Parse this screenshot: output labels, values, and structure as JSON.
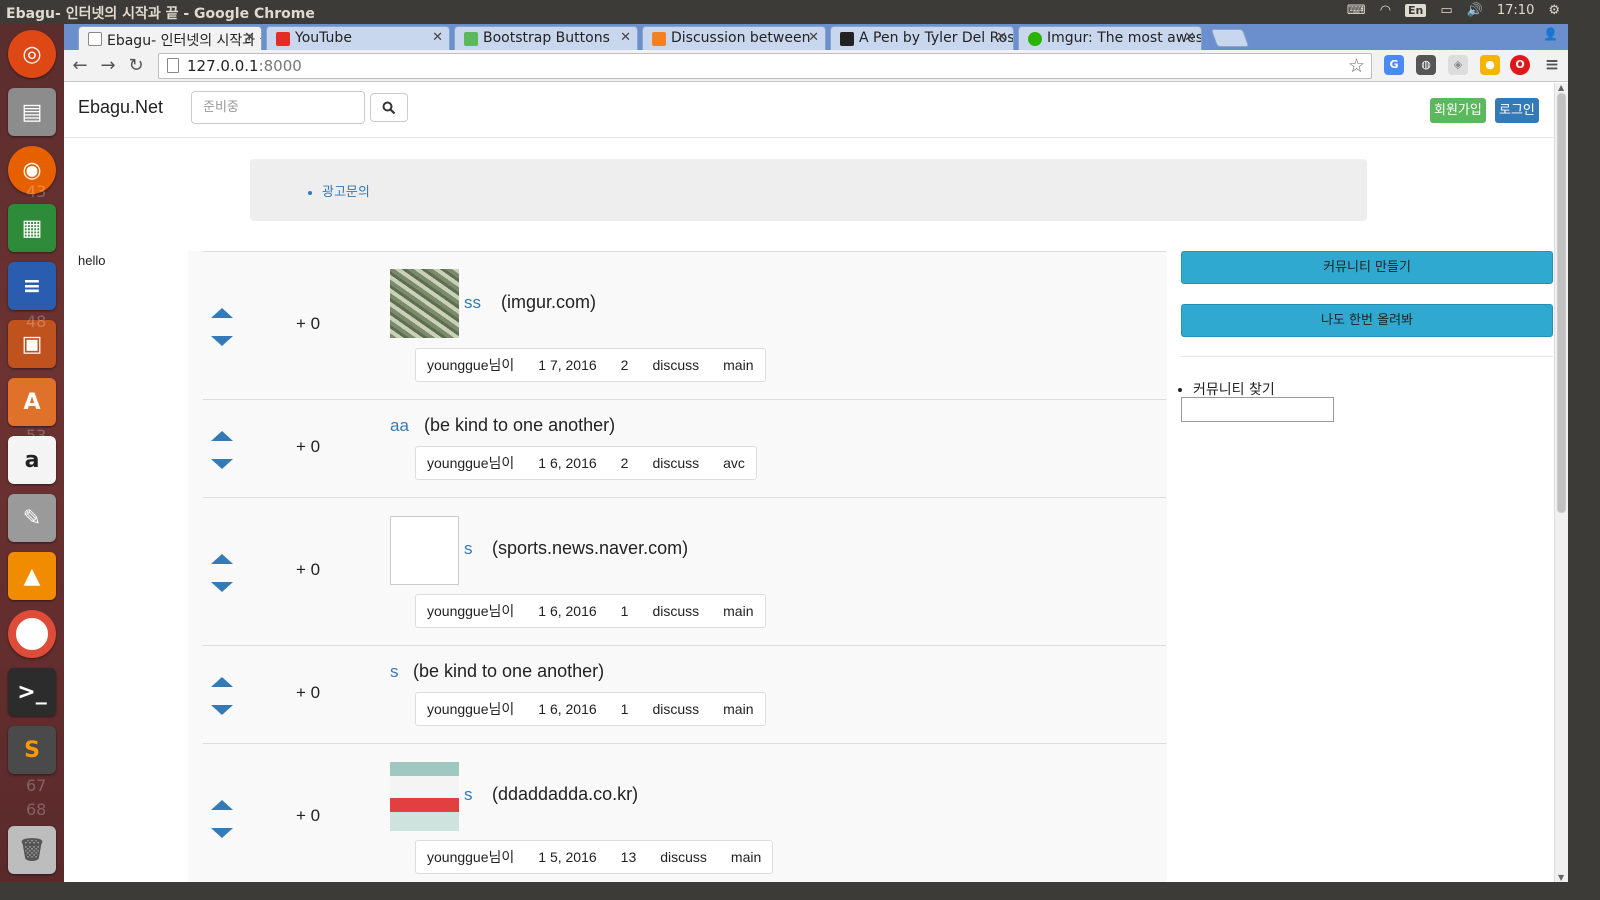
{
  "os": {
    "window_title": "Ebagu- 인터넷의 시작과 끝 - Google Chrome",
    "tray": {
      "lang": "En",
      "time": "17:10"
    },
    "launcher_numbers": [
      "43",
      "48",
      "53",
      "67",
      "68"
    ]
  },
  "browser": {
    "tabs": [
      {
        "label": "Ebagu- 인터넷의 시작과 끝",
        "active": true,
        "icon": "page-icon",
        "color": "#ffffff"
      },
      {
        "label": "YouTube",
        "active": false,
        "icon": "youtube-icon",
        "color": "#e52d27"
      },
      {
        "label": "Bootstrap Buttons",
        "active": false,
        "icon": "w3-icon",
        "color": "#5cb85c"
      },
      {
        "label": "Discussion between",
        "active": false,
        "icon": "stackoverflow-icon",
        "color": "#f48024"
      },
      {
        "label": "A Pen by Tyler Del Rosario",
        "active": false,
        "icon": "codepen-icon",
        "color": "#222222"
      },
      {
        "label": "Imgur: The most awesome",
        "active": false,
        "icon": "imgur-icon",
        "color": "#2ab400"
      }
    ],
    "url_host": "127.0.0.1",
    "url_port": ":8000"
  },
  "site": {
    "brand": "Ebagu.Net",
    "search_placeholder": "준비중",
    "signup_label": "회원가입",
    "login_label": "로그인",
    "ad_link": "광고문의",
    "hello": "hello",
    "posts": [
      {
        "score": "+ 0",
        "title": "ss",
        "domain": "(imgur.com)",
        "thumb": "money",
        "user": "younggue님이",
        "date": "1 7, 2016",
        "comments": "2",
        "discuss": "discuss",
        "board": "main"
      },
      {
        "score": "+ 0",
        "title": "aa",
        "domain": "(be kind to one another)",
        "thumb": "none",
        "user": "younggue님이",
        "date": "1 6, 2016",
        "comments": "2",
        "discuss": "discuss",
        "board": "avc"
      },
      {
        "score": "+ 0",
        "title": "s",
        "domain": "(sports.news.naver.com)",
        "thumb": "broken",
        "user": "younggue님이",
        "date": "1 6, 2016",
        "comments": "1",
        "discuss": "discuss",
        "board": "main"
      },
      {
        "score": "+ 0",
        "title": "s",
        "domain": "(be kind to one another)",
        "thumb": "none",
        "user": "younggue님이",
        "date": "1 6, 2016",
        "comments": "1",
        "discuss": "discuss",
        "board": "main"
      },
      {
        "score": "+ 0",
        "title": "s",
        "domain": "(ddaddadda.co.kr)",
        "thumb": "page",
        "user": "younggue님이",
        "date": "1 5, 2016",
        "comments": "13",
        "discuss": "discuss",
        "board": "main"
      }
    ],
    "sidebar": {
      "create_community": "커뮤니티 만들기",
      "post_something": "나도 한번 올려봐",
      "find_community": "커뮤니티 찾기"
    }
  }
}
